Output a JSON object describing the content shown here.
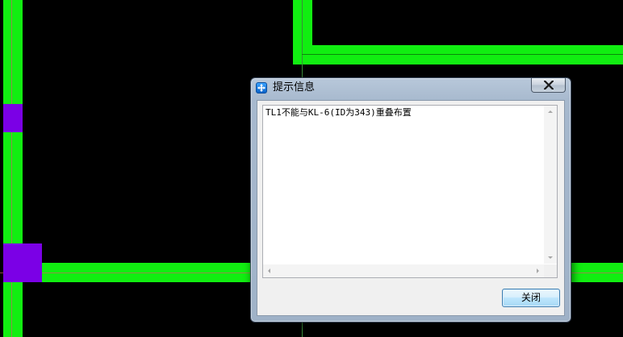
{
  "app": {
    "name": "CAD drawing canvas"
  },
  "colors": {
    "background": "#000000",
    "beam": "#11ee11",
    "column": "#7b00e6",
    "axis": "#c86464"
  },
  "dialog": {
    "title": "提示信息",
    "message": "TL1不能与KL-6(ID为343)重叠布置",
    "close_icon": "close-x-icon",
    "app_icon": "move-arrows-icon",
    "ok_button": "关闭"
  }
}
